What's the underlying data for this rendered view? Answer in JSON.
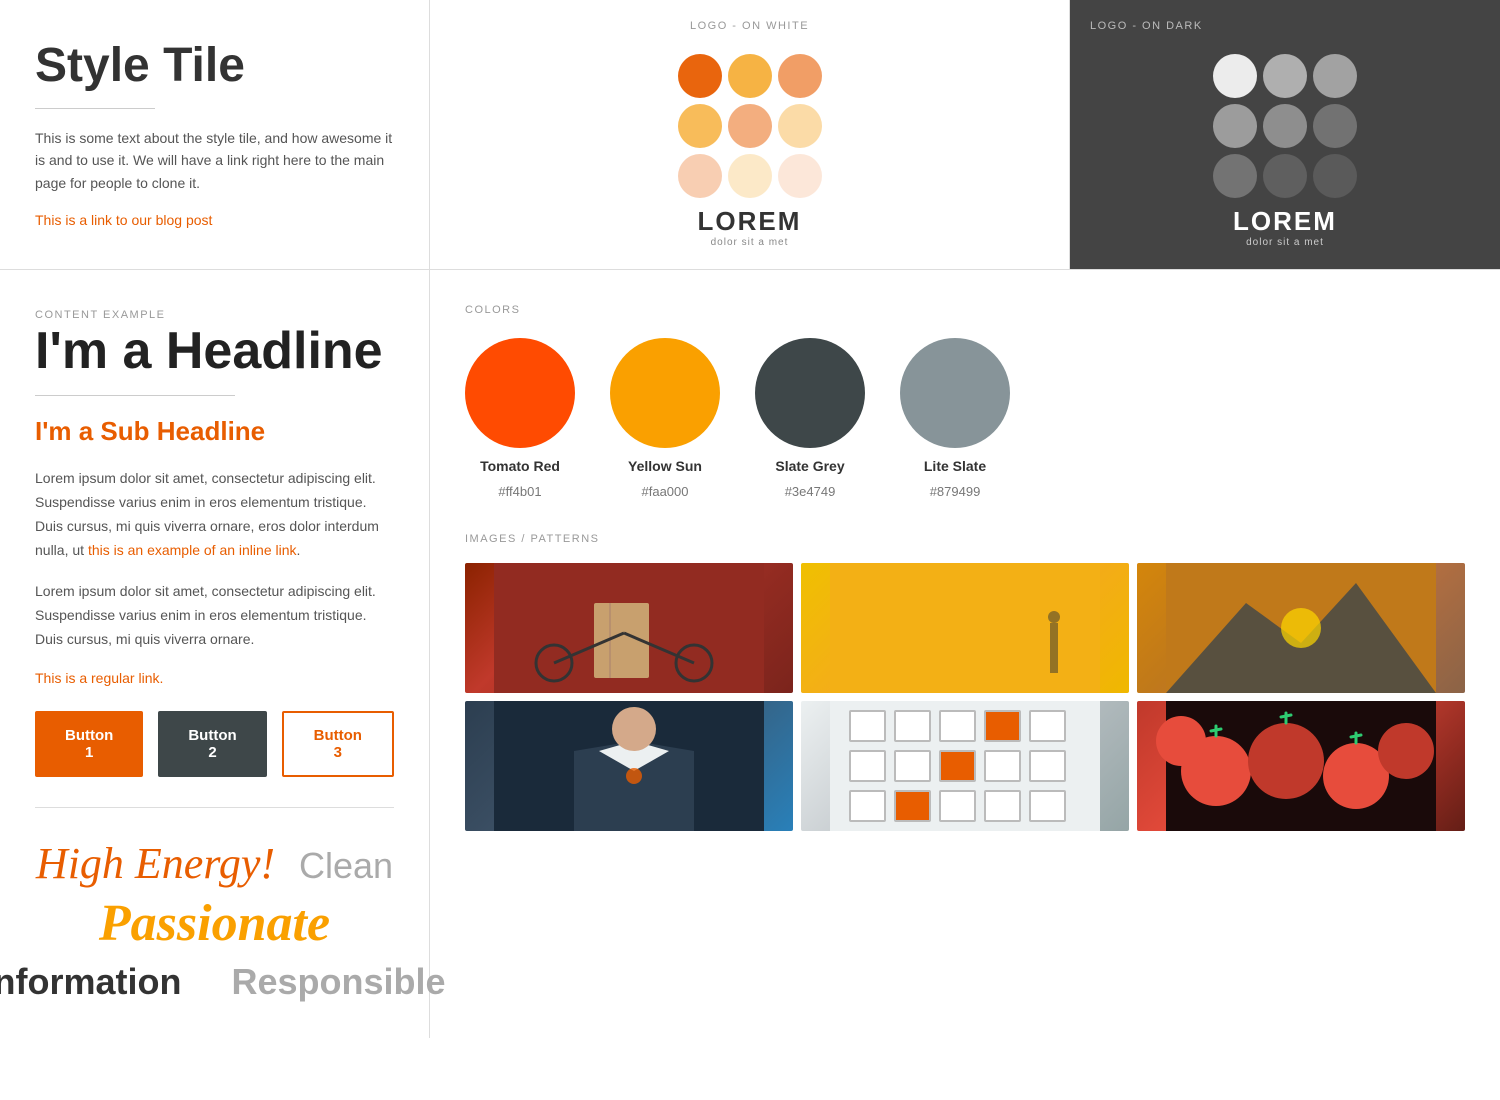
{
  "topLeft": {
    "title": "Style Tile",
    "description": "This is some text about the style tile, and how awesome it is and to use it. We will have a link right here to the main page for people to clone it.",
    "linkText": "This is a link to our blog post"
  },
  "topCenter": {
    "label": "LOGO - ON WHITE",
    "logoText": "LOREM",
    "logoSubtext": "dolor sit a met",
    "dots": [
      {
        "color": "#e85d00",
        "opacity": 0.9
      },
      {
        "color": "#f5a623",
        "opacity": 0.9
      },
      {
        "color": "#e85d00",
        "opacity": 0.7
      },
      {
        "color": "#f5a623",
        "opacity": 0.7
      },
      {
        "color": "#e85d00",
        "opacity": 0.5
      },
      {
        "color": "#f5a623",
        "opacity": 0.5
      },
      {
        "color": "#e85d00",
        "opacity": 0.3
      },
      {
        "color": "#f5a623",
        "opacity": 0.3
      },
      {
        "color": "#e85d00",
        "opacity": 0.1
      }
    ]
  },
  "topRight": {
    "label": "LOGO - ON DARK",
    "logoText": "LOREM",
    "logoSubtext": "dolor sit a met"
  },
  "contentExample": {
    "label": "CONTENT EXAMPLE",
    "headline": "I'm a Headline",
    "subheadline": "I'm a Sub Headline",
    "body1part1": "Lorem ipsum dolor sit amet, consectetur adipiscing elit. Suspendisse varius enim in eros elementum tristique. Duis cursus, mi quis viverra ornare, eros dolor interdum nulla, ut",
    "inlineLinkText": "this is an example of an inline link",
    "body1part2": ".",
    "body2": "Lorem ipsum dolor sit amet, consectetur adipiscing elit. Suspendisse varius enim in eros elementum tristique. Duis cursus, mi quis viverra ornare.",
    "regularLinkText": "This is a regular link.",
    "btn1": "Button 1",
    "btn2": "Button 2",
    "btn3": "Button 3"
  },
  "typography": {
    "word1": "High Energy!",
    "word2": "Clean",
    "word3": "Passionate",
    "word4": "Information",
    "word5": "Responsible"
  },
  "colors": {
    "label": "COLORS",
    "items": [
      {
        "name": "Tomato Red",
        "hex": "#ff4b01",
        "display": "#ff4b01"
      },
      {
        "name": "Yellow Sun",
        "hex": "#faa000",
        "display": "#faa000"
      },
      {
        "name": "Slate Grey",
        "hex": "#3e4749",
        "display": "#3e4749"
      },
      {
        "name": "Lite Slate",
        "hex": "#879499",
        "display": "#879499"
      }
    ]
  },
  "images": {
    "label": "IMAGES / PATTERNS"
  }
}
